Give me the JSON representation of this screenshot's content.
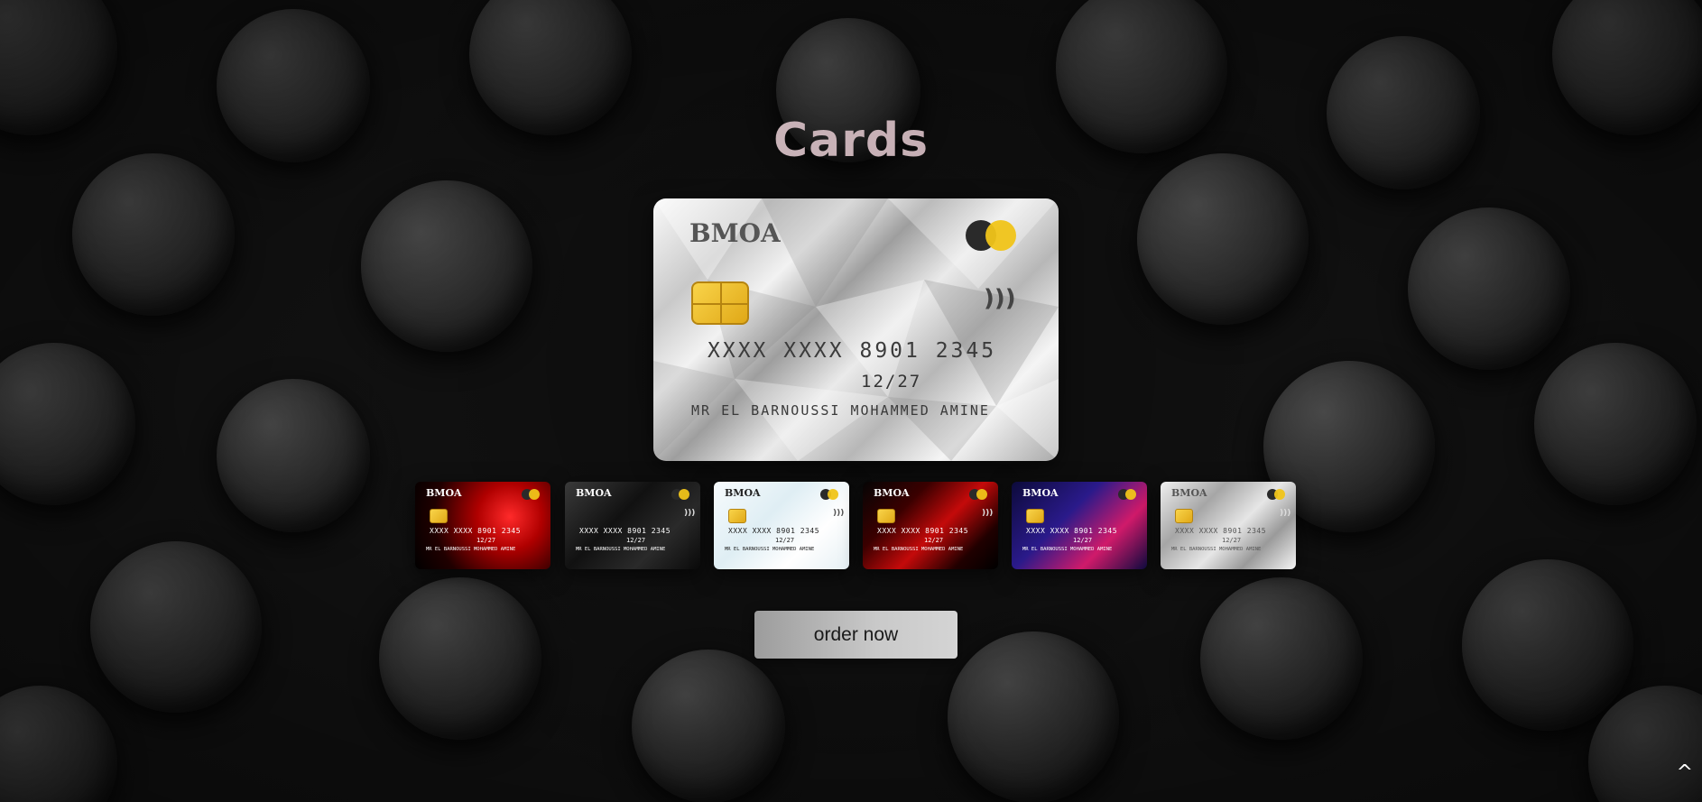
{
  "page": {
    "title": "Cards"
  },
  "main_card": {
    "bank": "BMOA",
    "number": "XXXX XXXX 8901 2345",
    "expiry": "12/27",
    "holder": "MR EL BARNOUSSI MOHAMMED AMINE"
  },
  "thumbnails": [
    {
      "bank": "BMOA",
      "number": "XXXX XXXX 8901 2345",
      "expiry": "12/27",
      "holder": "MR EL BARNOUSSI MOHAMMED AMINE"
    },
    {
      "bank": "BMOA",
      "number": "XXXX XXXX 8901 2345",
      "expiry": "12/27",
      "holder": "MR EL BARNOUSSI MOHAMMED AMINE"
    },
    {
      "bank": "BMOA",
      "number": "XXXX XXXX 8901 2345",
      "expiry": "12/27",
      "holder": "MR EL BARNOUSSI MOHAMMED AMINE"
    },
    {
      "bank": "BMOA",
      "number": "XXXX XXXX 8901 2345",
      "expiry": "12/27",
      "holder": "MR EL BARNOUSSI MOHAMMED AMINE"
    },
    {
      "bank": "BMOA",
      "number": "XXXX XXXX 8901 2345",
      "expiry": "12/27",
      "holder": "MR EL BARNOUSSI MOHAMMED AMINE"
    },
    {
      "bank": "BMOA",
      "number": "XXXX XXXX 8901 2345",
      "expiry": "12/27",
      "holder": "MR EL BARNOUSSI MOHAMMED AMINE"
    }
  ],
  "actions": {
    "order_label": "order now",
    "scroll_top_label": "^"
  },
  "icons": {
    "card_brand": "mastercard-logo-icon",
    "chip": "chip-icon",
    "contactless": "contactless-icon",
    "scroll_top": "caret-up-icon"
  },
  "colors": {
    "title_gradient_start": "#d6c8cc",
    "title_gradient_end": "#b99aa1",
    "button_bg": "#c9c9c9",
    "mastercard_yellow": "#f0c419",
    "chip_gold": "#f9d44a"
  }
}
